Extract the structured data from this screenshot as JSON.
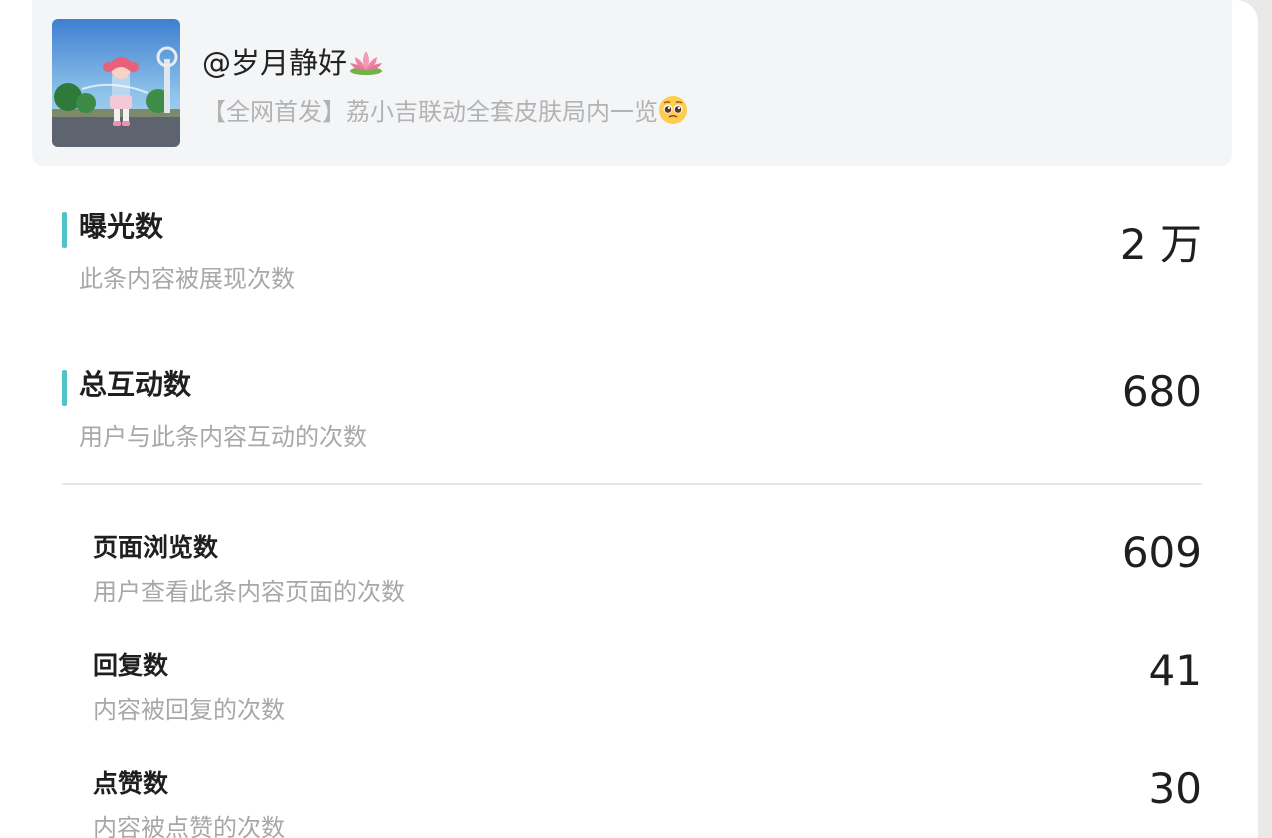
{
  "post": {
    "author": "@岁月静好",
    "author_emoji": "lotus-icon",
    "title": "【全网首发】荔小吉联动全套皮肤局内一览",
    "title_emoji": "pleading-face-icon"
  },
  "metrics": [
    {
      "name": "曝光数",
      "desc": "此条内容被展现次数",
      "value": "2 万"
    },
    {
      "name": "总互动数",
      "desc": "用户与此条内容互动的次数",
      "value": "680"
    }
  ],
  "breakdown": [
    {
      "name": "页面浏览数",
      "desc": "用户查看此条内容页面的次数",
      "value": "609"
    },
    {
      "name": "回复数",
      "desc": "内容被回复的次数",
      "value": "41"
    },
    {
      "name": "点赞数",
      "desc": "内容被点赞的次数",
      "value": "30"
    }
  ],
  "colors": {
    "accent_bar": "#4fc3c8",
    "card_background": "#f4f5f7",
    "secondary_text": "#a8a8a8"
  }
}
